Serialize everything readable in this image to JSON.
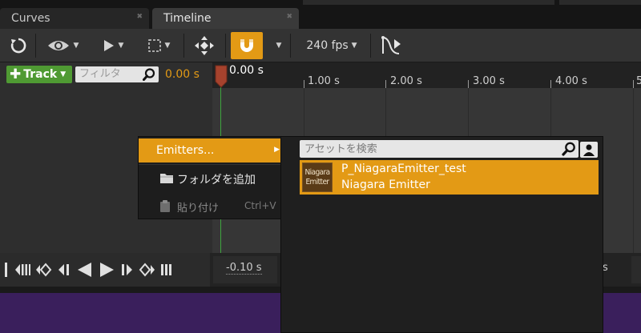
{
  "tabs": [
    {
      "label": "Curves",
      "active": false
    },
    {
      "label": "Timeline",
      "active": true
    }
  ],
  "toolbar": {
    "fps_label": "240 fps",
    "snap_active": true,
    "accent_color": "#e39a15"
  },
  "track": {
    "add_label": "Track",
    "filter_placeholder": "フィルタ",
    "current_time": "0.00 s"
  },
  "ruler": {
    "current_time_label": "0.00 s",
    "ticks": [
      "1.00 s",
      "2.00 s",
      "3.00 s",
      "4.00 s",
      "5"
    ]
  },
  "transport": {
    "range_start": "-0.10 s",
    "range_end_fragment": "s"
  },
  "context_menu": {
    "items": [
      {
        "label": "Emitters...",
        "highlighted": true,
        "has_submenu": true
      },
      {
        "label": "フォルダを追加",
        "icon": "folder-icon"
      },
      {
        "label": "貼り付け",
        "shortcut": "Ctrl+V",
        "disabled": true,
        "icon": "clipboard-icon"
      }
    ]
  },
  "asset_picker": {
    "search_placeholder": "アセットを検索",
    "assets": [
      {
        "name": "P_NiagaraEmitter_test",
        "type": "Niagara Emitter",
        "thumb_line1": "Niagara",
        "thumb_line2": "Emitter",
        "selected": true
      }
    ]
  }
}
